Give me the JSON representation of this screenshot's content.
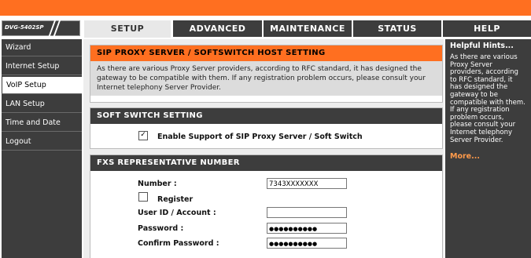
{
  "logo": {
    "text": "DVG-5402SP"
  },
  "tabs": [
    {
      "label": "SETUP"
    },
    {
      "label": "ADVANCED"
    },
    {
      "label": "MAINTENANCE"
    },
    {
      "label": "STATUS"
    },
    {
      "label": "HELP"
    }
  ],
  "sidebar": {
    "items": [
      {
        "label": "Wizard"
      },
      {
        "label": "Internet Setup"
      },
      {
        "label": "VoIP Setup"
      },
      {
        "label": "LAN Setup"
      },
      {
        "label": "Time and Date"
      },
      {
        "label": "Logout"
      }
    ]
  },
  "main": {
    "title": "SIP PROXY SERVER / SOFTSWITCH HOST SETTING",
    "desc": "As there are various Proxy Server providers, according to RFC standard, it has designed the gateway to be compatible with them. If any registration problem occurs, please consult your Internet telephony Server Provider.",
    "softswitch": {
      "header": "SOFT SWITCH SETTING",
      "enable_label": "Enable Support of SIP Proxy Server / Soft Switch",
      "checked": true
    },
    "fxs": {
      "header": "FXS REPRESENTATIVE NUMBER",
      "number_label": "Number :",
      "number_value": "7343XXXXXXX",
      "register_label": "Register",
      "register_checked": false,
      "userid_label": "User ID / Account :",
      "userid_value": "",
      "password_label": "Password :",
      "password_value": "●●●●●●●●●●",
      "confirm_label": "Confirm Password :",
      "confirm_value": "●●●●●●●●●●"
    }
  },
  "hints": {
    "title": "Helpful Hints...",
    "body": "As there are various Proxy Server providers, according to RFC standard, it has designed the gateway to be compatible with them. If any registration problem occurs, please consult your Internet telephony Server Provider.",
    "more": "More..."
  },
  "colors": {
    "accent": "#ff6f20",
    "dark": "#3d3d3d"
  }
}
